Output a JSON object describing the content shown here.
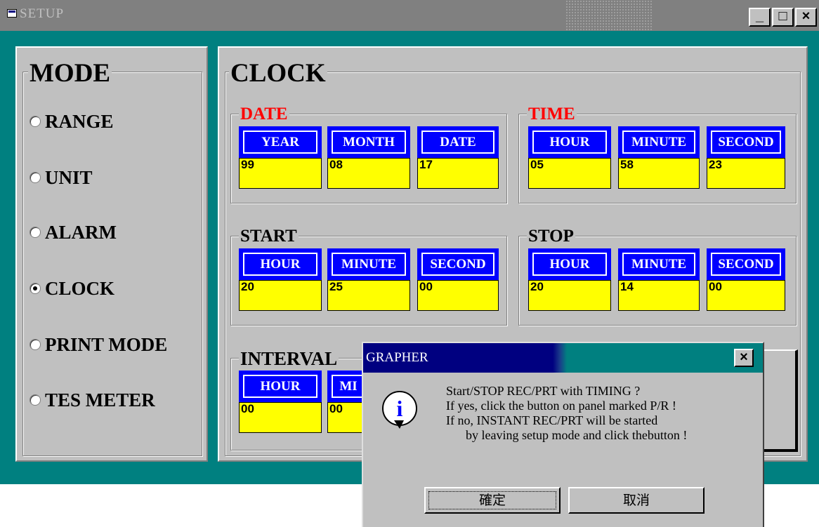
{
  "window": {
    "title": "SETUP",
    "minimize": "_",
    "maximize": "□",
    "close": "×"
  },
  "mode": {
    "title": "MODE",
    "selected": "CLOCK",
    "items": [
      {
        "label": "RANGE",
        "checked": false
      },
      {
        "label": "UNIT",
        "checked": false
      },
      {
        "label": "ALARM",
        "checked": false
      },
      {
        "label": "CLOCK",
        "checked": true
      },
      {
        "label": "PRINT MODE",
        "checked": false
      },
      {
        "label": "TES METER",
        "checked": false
      }
    ]
  },
  "clock": {
    "title": "CLOCK",
    "date": {
      "caption": "DATE",
      "headers": [
        "YEAR",
        "MONTH",
        "DATE"
      ],
      "values": [
        "99",
        "08",
        "17"
      ]
    },
    "time": {
      "caption": "TIME",
      "headers": [
        "HOUR",
        "MINUTE",
        "SECOND"
      ],
      "values": [
        "05",
        "58",
        "23"
      ]
    },
    "start": {
      "caption": "START",
      "headers": [
        "HOUR",
        "MINUTE",
        "SECOND"
      ],
      "values": [
        "20",
        "25",
        "00"
      ]
    },
    "stop": {
      "caption": "STOP",
      "headers": [
        "HOUR",
        "MINUTE",
        "SECOND"
      ],
      "values": [
        "20",
        "14",
        "00"
      ]
    },
    "interval": {
      "caption": "INTERVAL",
      "headers": [
        "HOUR",
        "MI"
      ],
      "values": [
        "00",
        "00"
      ]
    }
  },
  "dialog": {
    "title": "GRAPHER",
    "close": "×",
    "icon": "information-icon",
    "lines": [
      "Start/STOP REC/PRT with TIMING ?",
      "If yes, click the button on panel marked P/R !",
      "If no, INSTANT REC/PRT will be started",
      "by leaving setup mode and click thebutton !"
    ],
    "ok_label": "確定",
    "cancel_label": "取消"
  },
  "colors": {
    "header_blue": "#0000ff",
    "value_yellow": "#ffff00",
    "caption_red": "#ff0000",
    "teal": "#008080"
  }
}
